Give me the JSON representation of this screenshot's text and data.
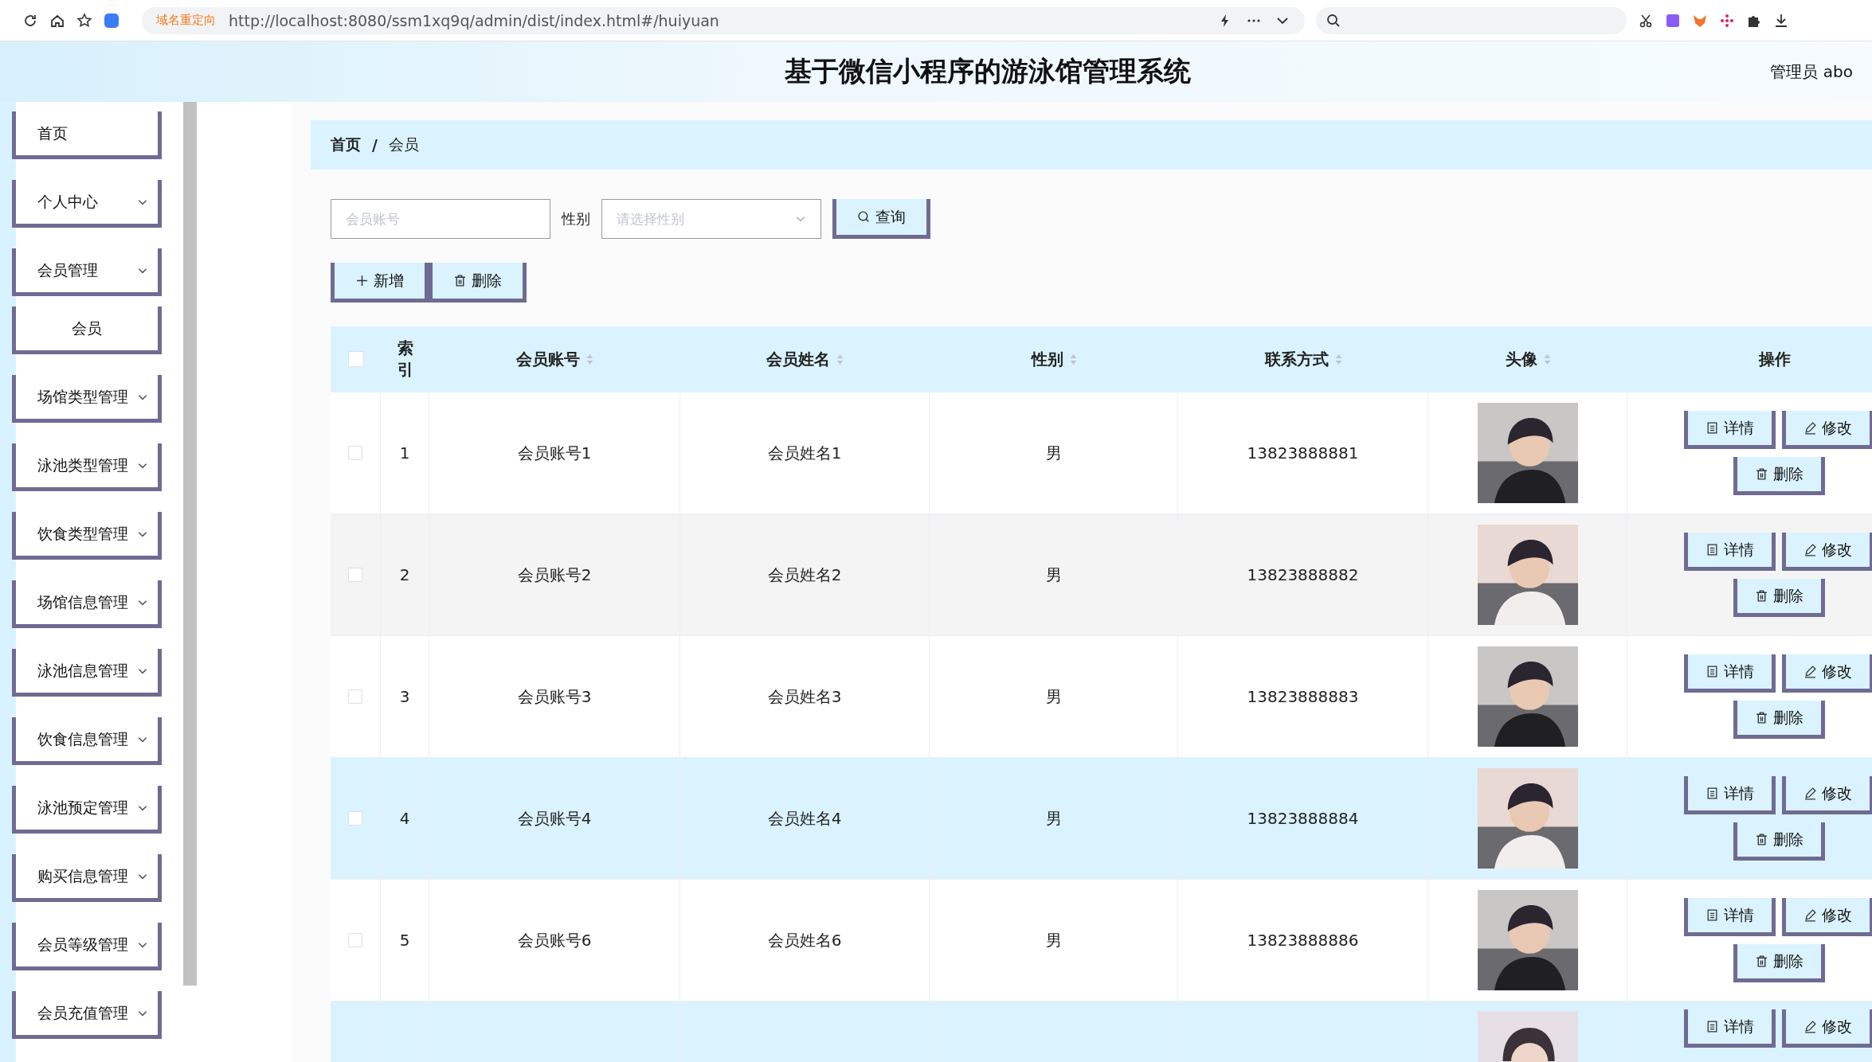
{
  "browser": {
    "redirect_label": "域名重定向",
    "url": "http://localhost:8080/ssm1xq9q/admin/dist/index.html#/huiyuan"
  },
  "header": {
    "title": "基于微信小程序的游泳馆管理系统",
    "user": "管理员 abo"
  },
  "sidebar": {
    "items": [
      {
        "label": "首页",
        "kind": "link"
      },
      {
        "label": "个人中心",
        "kind": "menu"
      },
      {
        "label": "会员管理",
        "kind": "menu",
        "children": [
          {
            "label": "会员"
          }
        ]
      },
      {
        "label": "场馆类型管理",
        "kind": "menu"
      },
      {
        "label": "泳池类型管理",
        "kind": "menu"
      },
      {
        "label": "饮食类型管理",
        "kind": "menu"
      },
      {
        "label": "场馆信息管理",
        "kind": "menu"
      },
      {
        "label": "泳池信息管理",
        "kind": "menu"
      },
      {
        "label": "饮食信息管理",
        "kind": "menu"
      },
      {
        "label": "泳池预定管理",
        "kind": "menu"
      },
      {
        "label": "购买信息管理",
        "kind": "menu"
      },
      {
        "label": "会员等级管理",
        "kind": "menu"
      },
      {
        "label": "会员充值管理",
        "kind": "menu"
      }
    ]
  },
  "breadcrumb": [
    "首页",
    "会员"
  ],
  "breadcrumb_separator": "/",
  "search": {
    "account_placeholder": "会员账号",
    "gender_label": "性别",
    "gender_placeholder": "请选择性别",
    "query_button": "查询"
  },
  "actions": [
    "新增",
    "删除"
  ],
  "table": {
    "columns": [
      {
        "label": "索引",
        "sortable": false
      },
      {
        "label": "会员账号",
        "sortable": true
      },
      {
        "label": "会员姓名",
        "sortable": true
      },
      {
        "label": "性别",
        "sortable": true
      },
      {
        "label": "联系方式",
        "sortable": true
      },
      {
        "label": "头像",
        "sortable": true
      },
      {
        "label": "操作",
        "sortable": false
      }
    ],
    "rows": [
      {
        "index": "1",
        "account": "会员账号1",
        "name": "会员姓名1",
        "gender": "男",
        "phone": "13823888881",
        "kind": "plain",
        "checked": false,
        "buttons": [
          "详情",
          "修改",
          "删除"
        ]
      },
      {
        "index": "2",
        "account": "会员账号2",
        "name": "会员姓名2",
        "gender": "男",
        "phone": "13823888882",
        "kind": "striped",
        "checked": false,
        "buttons": [
          "详情",
          "修改",
          "删除"
        ]
      },
      {
        "index": "3",
        "account": "会员账号3",
        "name": "会员姓名3",
        "gender": "男",
        "phone": "13823888883",
        "kind": "plain",
        "checked": false,
        "buttons": [
          "详情",
          "修改",
          "删除"
        ]
      },
      {
        "index": "4",
        "account": "会员账号4",
        "name": "会员姓名4",
        "gender": "男",
        "phone": "13823888884",
        "kind": "highlighted",
        "checked": false,
        "buttons": [
          "详情",
          "修改",
          "删除"
        ]
      },
      {
        "index": "5",
        "account": "会员账号6",
        "name": "会员姓名6",
        "gender": "男",
        "phone": "13823888886",
        "kind": "plain",
        "checked": false,
        "buttons": [
          "详情",
          "修改",
          "删除"
        ]
      }
    ],
    "select_all_checked": false,
    "cut_row": {
      "kind": "highlighted",
      "buttons": [
        "详情",
        "修改"
      ]
    }
  }
}
